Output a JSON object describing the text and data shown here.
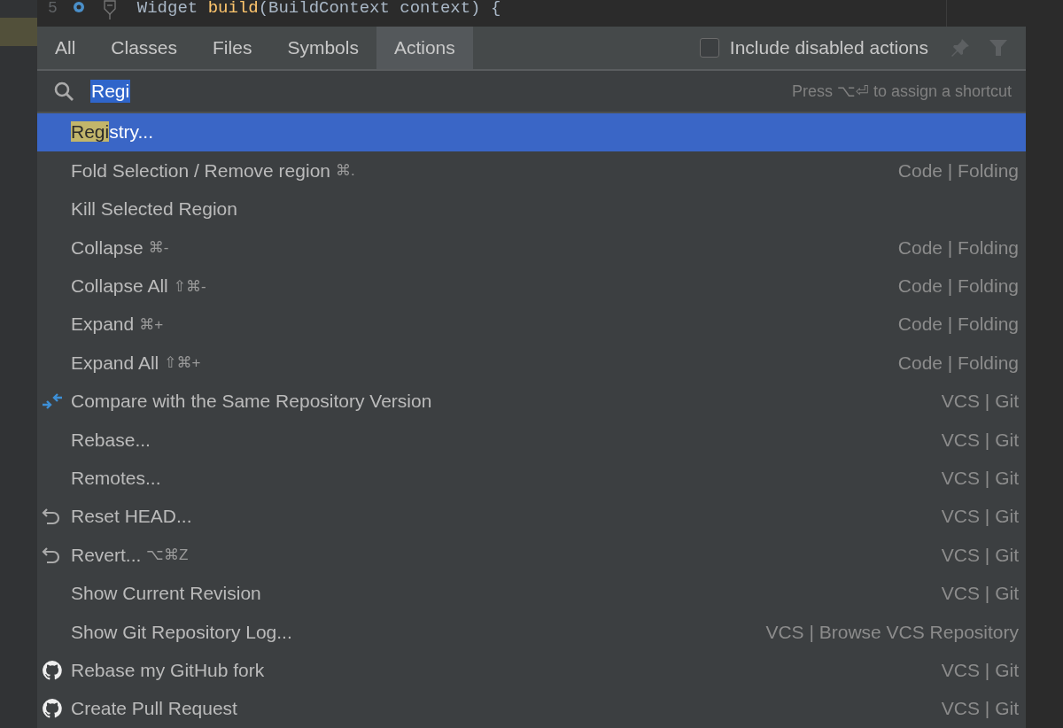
{
  "editor": {
    "line_number": "5",
    "code": [
      {
        "text": "Widget ",
        "kind": "plain"
      },
      {
        "text": "build",
        "kind": "fn"
      },
      {
        "text": "(BuildContext context) {",
        "kind": "plain"
      }
    ]
  },
  "tabs": [
    {
      "label": "All",
      "selected": false
    },
    {
      "label": "Classes",
      "selected": false
    },
    {
      "label": "Files",
      "selected": false
    },
    {
      "label": "Symbols",
      "selected": false
    },
    {
      "label": "Actions",
      "selected": true
    }
  ],
  "include_disabled": {
    "label": "Include disabled actions",
    "checked": false
  },
  "search": {
    "value": "Regi",
    "hint": "Press ⌥⏎ to assign a shortcut"
  },
  "items": [
    {
      "highlight": "Regi",
      "label": "stry...",
      "selected": true
    },
    {
      "label": "Fold Selection / Remove region",
      "shortcut": "⌘.",
      "category": "Code | Folding",
      "selected": false
    },
    {
      "label": "Kill Selected Region",
      "selected": false
    },
    {
      "label": "Collapse",
      "shortcut": "⌘-",
      "category": "Code | Folding",
      "selected": false
    },
    {
      "label": "Collapse All",
      "shortcut": "⇧⌘-",
      "category": "Code | Folding",
      "selected": false
    },
    {
      "label": "Expand",
      "shortcut": "⌘+",
      "category": "Code | Folding",
      "selected": false
    },
    {
      "label": "Expand All",
      "shortcut": "⇧⌘+",
      "category": "Code | Folding",
      "selected": false
    },
    {
      "kind": "compare",
      "label": "Compare with the Same Repository Version",
      "category": "VCS | Git",
      "selected": false
    },
    {
      "label": "Rebase...",
      "category": "VCS | Git",
      "selected": false
    },
    {
      "label": "Remotes...",
      "category": "VCS | Git",
      "selected": false
    },
    {
      "kind": "undo",
      "label": "Reset HEAD...",
      "category": "VCS | Git",
      "selected": false
    },
    {
      "kind": "undo",
      "label": "Revert...",
      "shortcut": "⌥⌘Z",
      "category": "VCS | Git",
      "selected": false
    },
    {
      "label": "Show Current Revision",
      "category": "VCS | Git",
      "selected": false
    },
    {
      "label": "Show Git Repository Log...",
      "category": "VCS | Browse VCS Repository",
      "selected": false
    },
    {
      "kind": "github",
      "label": "Rebase my GitHub fork",
      "category": "VCS | Git",
      "selected": false
    },
    {
      "kind": "github",
      "label": "Create Pull Request",
      "category": "VCS | Git",
      "selected": false
    }
  ]
}
